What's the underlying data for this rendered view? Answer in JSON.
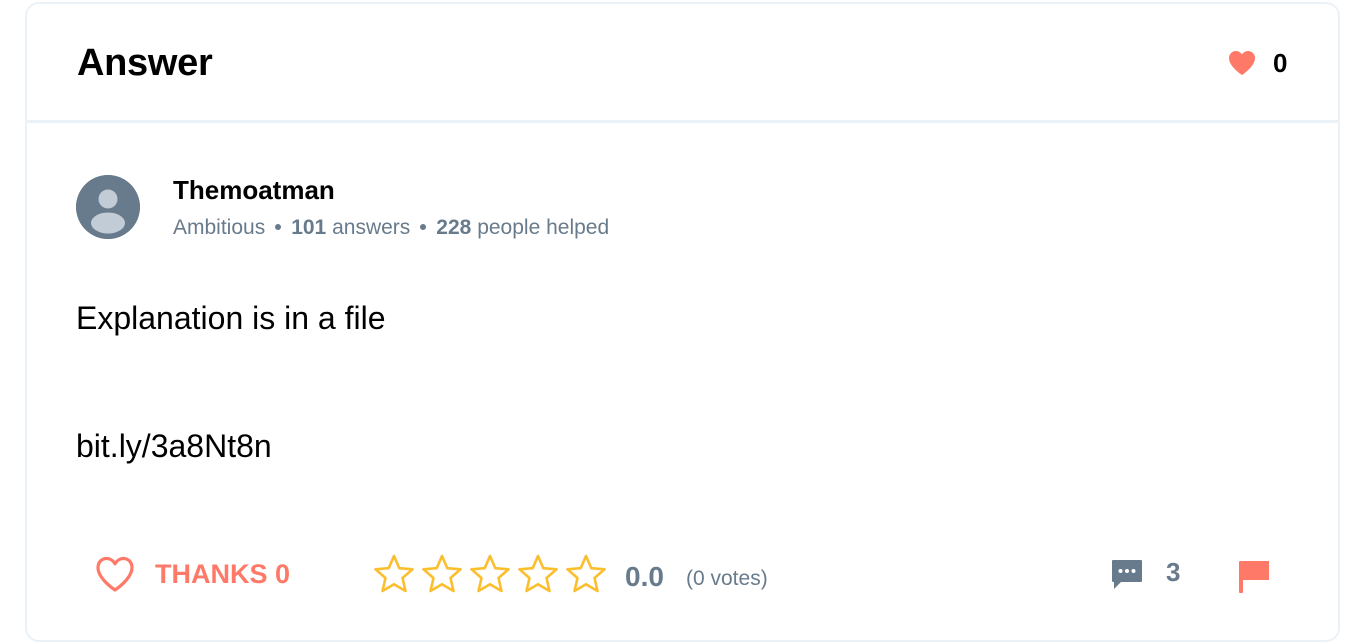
{
  "header": {
    "title": "Answer",
    "likes_count": "0"
  },
  "author": {
    "name": "Themoatman",
    "rank": "Ambitious",
    "answers_count": "101",
    "answers_label": "answers",
    "helped_count": "228",
    "helped_label": "people helped"
  },
  "answer": {
    "text": "Explanation is in a file",
    "link": "bit.ly/3a8Nt8n"
  },
  "actions": {
    "thanks_label": "THANKS 0",
    "rating_value": "0.0",
    "votes_label": "(0 votes)",
    "comments_count": "3"
  },
  "colors": {
    "accent_red": "#ff7968",
    "star_gold": "#fbbe2e",
    "muted_gray": "#687b8c",
    "border": "#ebf2f7"
  },
  "icons": {
    "header_heart": "heart-filled-icon",
    "avatar": "user-placeholder-icon",
    "thanks": "heart-outline-icon",
    "stars": "star-outline-icon",
    "comments": "comment-bubble-icon",
    "report": "flag-icon"
  }
}
